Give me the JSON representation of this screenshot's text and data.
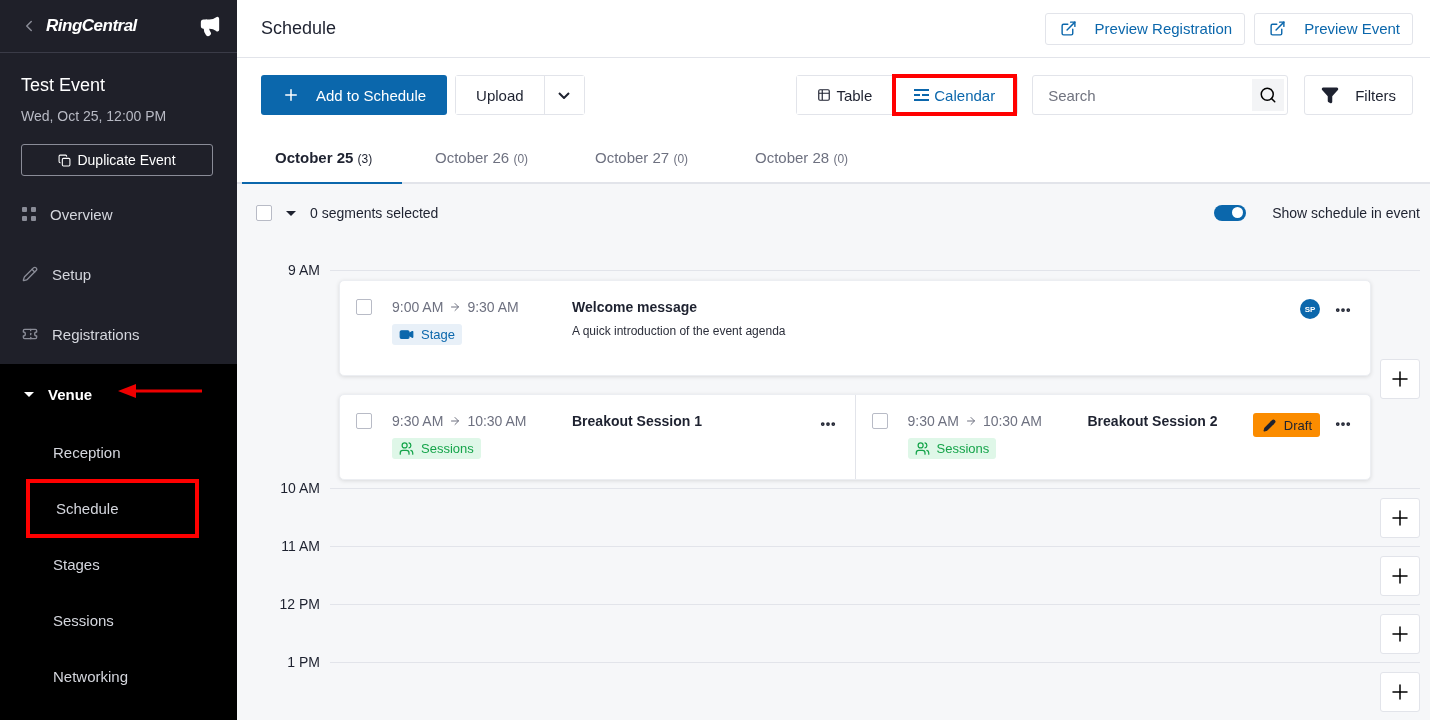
{
  "sidebar": {
    "logo": "RingCentral",
    "event": {
      "title": "Test Event",
      "date": "Wed, Oct 25, 12:00 PM"
    },
    "duplicate_button": "Duplicate Event",
    "items": [
      {
        "kind": "overview",
        "label": "Overview"
      },
      {
        "kind": "setup",
        "label": "Setup"
      },
      {
        "kind": "registrations",
        "label": "Registrations"
      },
      {
        "kind": "group",
        "label": "Venue",
        "expanded": true,
        "annotation_arrow": true,
        "children": [
          {
            "label": "Reception",
            "highlighted": false
          },
          {
            "label": "Schedule",
            "highlighted": true
          },
          {
            "label": "Stages",
            "highlighted": false
          },
          {
            "label": "Sessions",
            "highlighted": false
          },
          {
            "label": "Networking",
            "highlighted": false
          }
        ]
      }
    ]
  },
  "header": {
    "title": "Schedule",
    "buttons": [
      "Preview Registration",
      "Preview Event"
    ]
  },
  "toolbar": {
    "add_button": "Add to Schedule",
    "upload_button": "Upload",
    "views": [
      {
        "kind": "table",
        "label": "Table",
        "selected": false,
        "highlighted": false
      },
      {
        "kind": "calendar",
        "label": "Calendar",
        "selected": true,
        "highlighted": true
      }
    ],
    "search": {
      "placeholder": "Search"
    },
    "filters_button": "Filters"
  },
  "tabs": [
    {
      "label": "October 25",
      "count": "(3)",
      "selected": true
    },
    {
      "label": "October 26",
      "count": "(0)",
      "selected": false
    },
    {
      "label": "October 27",
      "count": "(0)",
      "selected": false
    },
    {
      "label": "October 28",
      "count": "(0)",
      "selected": false
    }
  ],
  "selection": {
    "checked": false,
    "label": "0 segments selected"
  },
  "show_schedule": {
    "label": "Show schedule in event",
    "on": true
  },
  "calendar": {
    "hours": [
      {
        "label": "9 AM",
        "rows": [
          [
            {
              "checked": false,
              "start": "9:00 AM",
              "end": "9:30 AM",
              "title": "Welcome message",
              "description": "A quick introduction of the event agenda",
              "tag": {
                "kind": "stage",
                "label": "Stage"
              },
              "avatar": "SP"
            }
          ],
          [
            {
              "checked": false,
              "start": "9:30 AM",
              "end": "10:30 AM",
              "title": "Breakout Session 1",
              "tag": {
                "kind": "sessions",
                "label": "Sessions"
              }
            },
            {
              "checked": false,
              "start": "9:30 AM",
              "end": "10:30 AM",
              "title": "Breakout Session 2",
              "tag": {
                "kind": "sessions",
                "label": "Sessions"
              },
              "status": "Draft"
            }
          ]
        ]
      },
      {
        "label": "10 AM"
      },
      {
        "label": "11 AM"
      },
      {
        "label": "12 PM"
      },
      {
        "label": "1 PM"
      }
    ]
  }
}
